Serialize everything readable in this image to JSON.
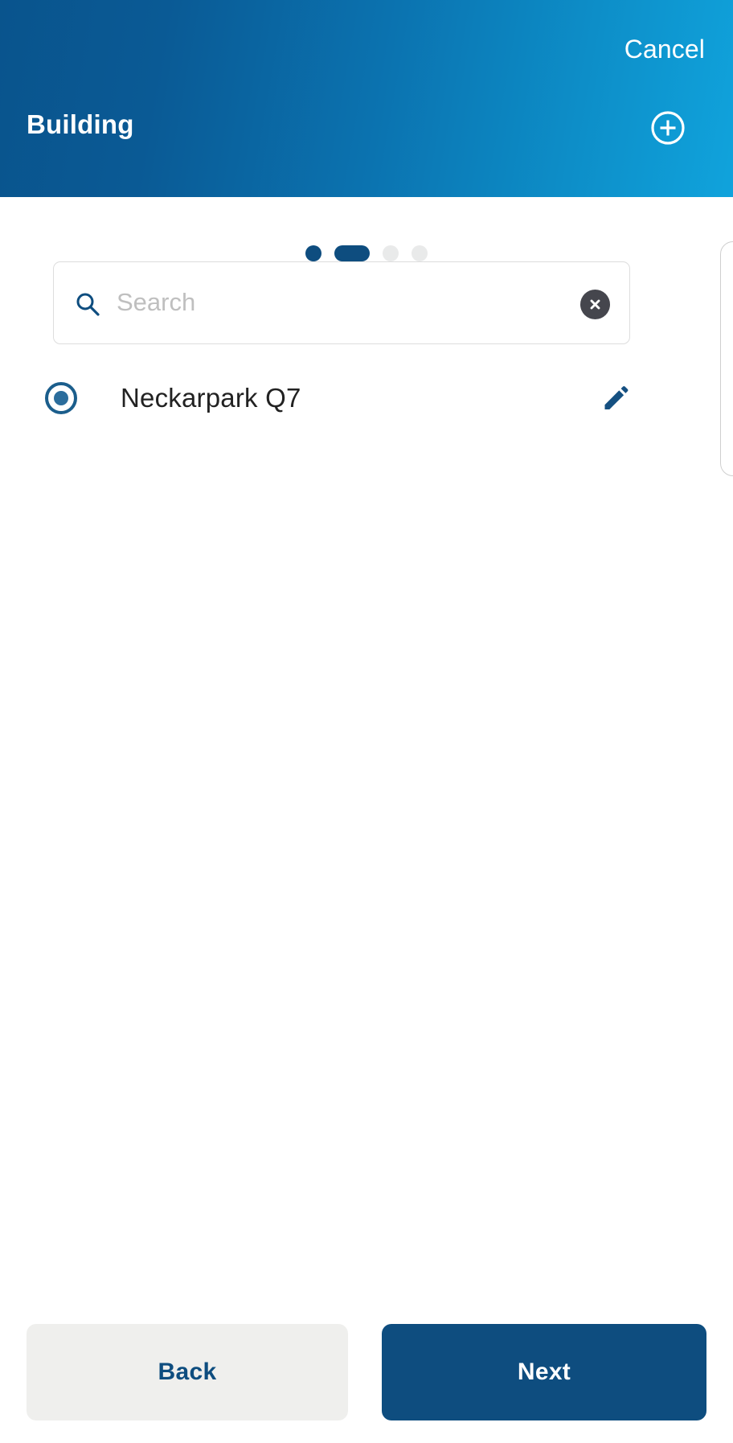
{
  "header": {
    "cancel_label": "Cancel",
    "title": "Building",
    "add_icon": "plus-circle-icon",
    "gradient_from": "#09548D",
    "gradient_to": "#10A3DC"
  },
  "pagination": {
    "total_steps": 4,
    "current_step": 2,
    "active_color": "#0E4D7F",
    "inactive_color": "#E9EAEA",
    "steps": [
      {
        "index": 1,
        "state": "visited"
      },
      {
        "index": 2,
        "state": "active"
      },
      {
        "index": 3,
        "state": "upcoming"
      },
      {
        "index": 4,
        "state": "upcoming"
      }
    ]
  },
  "search": {
    "value": "",
    "placeholder": "Search",
    "search_icon": "search-icon",
    "clear_icon": "close-circle-icon",
    "clear_bg": "#45464D",
    "icon_color": "#0E4D7F"
  },
  "list": {
    "rows": [
      {
        "label": "Neckarpark Q7",
        "selected": true,
        "radio_icon": "radio-selected-icon",
        "edit_icon": "pencil-icon"
      }
    ]
  },
  "footer": {
    "back_label": "Back",
    "next_label": "Next",
    "back_bg": "#EFEFED",
    "back_text": "#0E4D7F",
    "next_bg": "#0E4D7F",
    "next_text": "#FFFFFF"
  }
}
